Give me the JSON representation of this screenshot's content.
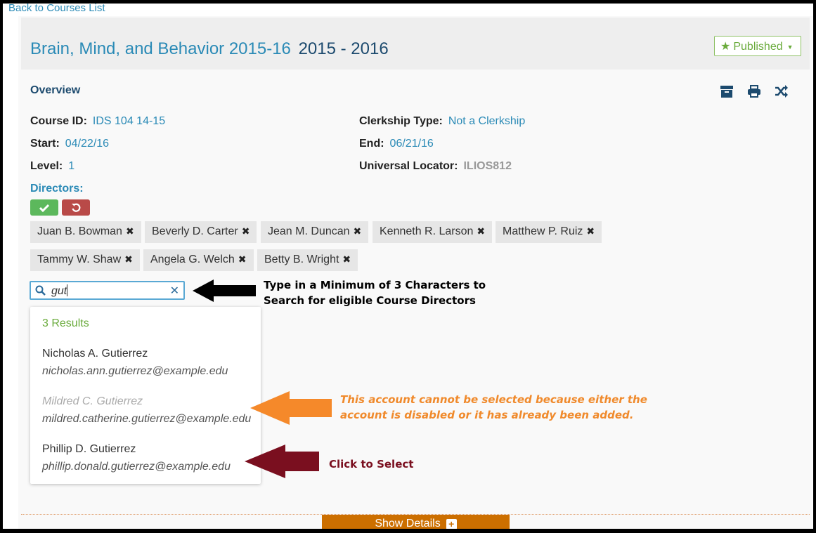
{
  "nav": {
    "back_link": "Back to Courses List"
  },
  "course": {
    "title": "Brain, Mind, and Behavior 2015-16",
    "year": "2015 - 2016",
    "status_button": "Published"
  },
  "overview": {
    "heading": "Overview",
    "course_id_label": "Course ID:",
    "course_id": "IDS 104 14-15",
    "start_label": "Start:",
    "start": "04/22/16",
    "level_label": "Level:",
    "level": "1",
    "clerkship_label": "Clerkship Type:",
    "clerkship": "Not a Clerkship",
    "end_label": "End:",
    "end": "06/21/16",
    "locator_label": "Universal Locator:",
    "locator": "ILIOS812",
    "directors_label": "Directors:"
  },
  "directors": [
    "Juan B. Bowman",
    "Beverly D. Carter",
    "Jean M. Duncan",
    "Kenneth R. Larson",
    "Matthew P. Ruiz",
    "Tammy W. Shaw",
    "Angela G. Welch",
    "Betty B. Wright"
  ],
  "search": {
    "value": "gut",
    "results_count": "3 Results"
  },
  "results": [
    {
      "name": "Nicholas A. Gutierrez",
      "email": "nicholas.ann.gutierrez@example.edu",
      "disabled": false
    },
    {
      "name": "Mildred C. Gutierrez",
      "email": "mildred.catherine.gutierrez@example.edu",
      "disabled": true
    },
    {
      "name": "Phillip D. Gutierrez",
      "email": "phillip.donald.gutierrez@example.edu",
      "disabled": false
    }
  ],
  "annotations": {
    "search_hint_1": "Type in a Minimum of 3 Characters to",
    "search_hint_2": "Search for eligible Course Directors",
    "disabled_hint_1": "This account cannot be selected because either the",
    "disabled_hint_2": "account is disabled or it has already been added.",
    "select_hint": "Click to Select"
  },
  "footer": {
    "show_details": "Show Details"
  },
  "colors": {
    "link_blue": "#2a8ab6",
    "published_green": "#6aab3c",
    "annotation_orange": "#f08a2c",
    "annotation_maroon": "#7a0f1f",
    "show_details_bg": "#cc6f00"
  }
}
